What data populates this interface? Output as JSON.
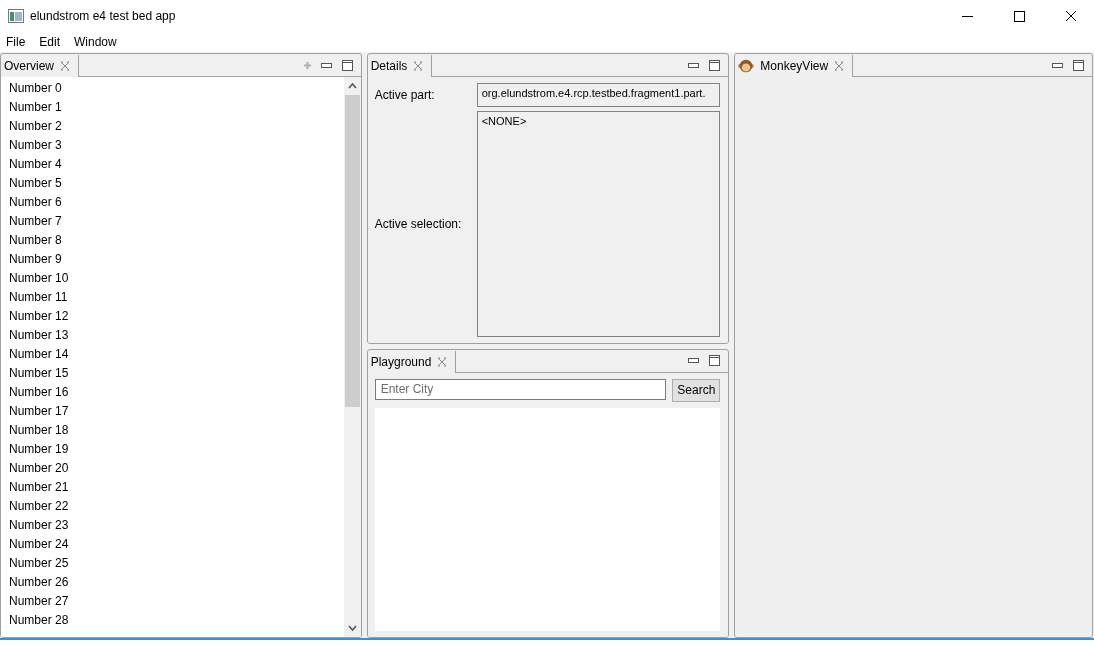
{
  "window": {
    "title": "elundstrom e4 test bed app"
  },
  "menu": [
    "File",
    "Edit",
    "Window"
  ],
  "overview": {
    "tab": "Overview",
    "items": [
      "Number 0",
      "Number 1",
      "Number 2",
      "Number 3",
      "Number 4",
      "Number 5",
      "Number 6",
      "Number 7",
      "Number 8",
      "Number 9",
      "Number 10",
      "Number 11",
      "Number 12",
      "Number 13",
      "Number 14",
      "Number 15",
      "Number 16",
      "Number 17",
      "Number 18",
      "Number 19",
      "Number 20",
      "Number 21",
      "Number 22",
      "Number 23",
      "Number 24",
      "Number 25",
      "Number 26",
      "Number 27",
      "Number 28"
    ]
  },
  "details": {
    "tab": "Details",
    "active_part_label": "Active part:",
    "active_part_value": "org.elundstrom.e4.rcp.testbed.fragment1.part.",
    "active_selection_label": "Active selection:",
    "active_selection_value": "<NONE>"
  },
  "playground": {
    "tab": "Playground",
    "search": {
      "placeholder": "Enter City"
    },
    "button": "Search"
  },
  "monkey": {
    "tab": "MonkeyView"
  }
}
